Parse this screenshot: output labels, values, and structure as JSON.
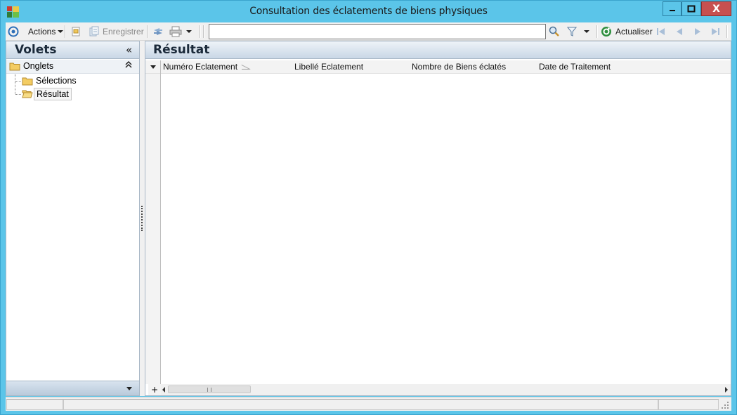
{
  "window": {
    "title": "Consultation des éclatements de biens physiques",
    "controls": {
      "minimize": "▁",
      "maximize": "□",
      "close": "X"
    }
  },
  "toolbar": {
    "actions_label": "Actions",
    "save_label": "Enregistrer",
    "search": {
      "value": "",
      "placeholder": ""
    },
    "refresh_label": "Actualiser"
  },
  "left_panel": {
    "title": "Volets",
    "collapse_glyph": "«",
    "group": {
      "label": "Onglets",
      "chevron": "⌃"
    },
    "items": [
      {
        "label": "Sélections",
        "selected": false
      },
      {
        "label": "Résultat",
        "selected": true
      }
    ]
  },
  "right_panel": {
    "title": "Résultat",
    "columns": [
      {
        "label": "Numéro Eclatement",
        "sorted": true
      },
      {
        "label": "Libellé Eclatement",
        "sorted": false
      },
      {
        "label": "Nombre de Biens éclatés",
        "sorted": false
      },
      {
        "label": "Date de Traitement",
        "sorted": false
      }
    ],
    "rows": [],
    "add_row_glyph": "+"
  },
  "colors": {
    "window_frame": "#5bc5e9",
    "close_button": "#c75050",
    "panel_header_top": "#eef3f8",
    "panel_header_bottom": "#c9d7e6"
  }
}
